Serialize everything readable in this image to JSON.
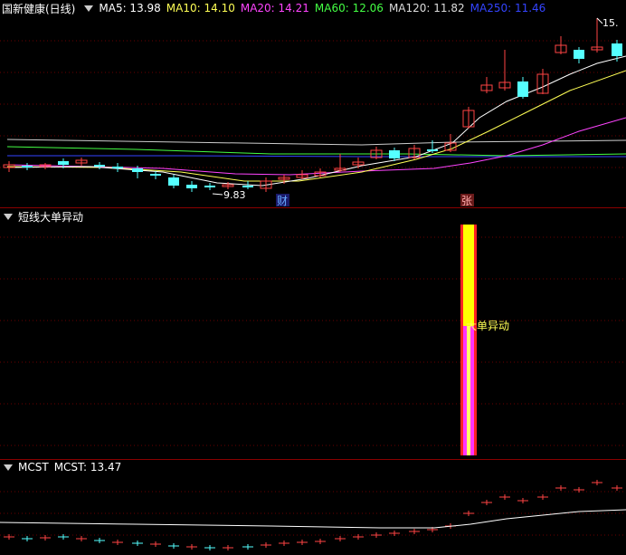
{
  "main": {
    "title": "国新健康(日线)",
    "ma": [
      {
        "label": "MA5: 13.98",
        "color": "#ffffff"
      },
      {
        "label": "MA10: 14.10",
        "color": "#ffff55"
      },
      {
        "label": "MA20: 14.21",
        "color": "#ff44ff"
      },
      {
        "label": "MA60: 12.06",
        "color": "#44ff44"
      },
      {
        "label": "MA120: 11.82",
        "color": "#dddddd"
      },
      {
        "label": "MA250: 11.46",
        "color": "#3344ff"
      }
    ],
    "low_label": "9.83",
    "high_label": "15.",
    "marker_cai": "财",
    "marker_zhang": "张"
  },
  "sub1": {
    "title": "短线大单异动",
    "bar_label": "大单异动"
  },
  "sub2": {
    "title": "MCST",
    "value_label": "MCST: 13.47"
  },
  "colors": {
    "up": "#ff4444",
    "down": "#55ffff",
    "grid": "#8a0000"
  }
}
